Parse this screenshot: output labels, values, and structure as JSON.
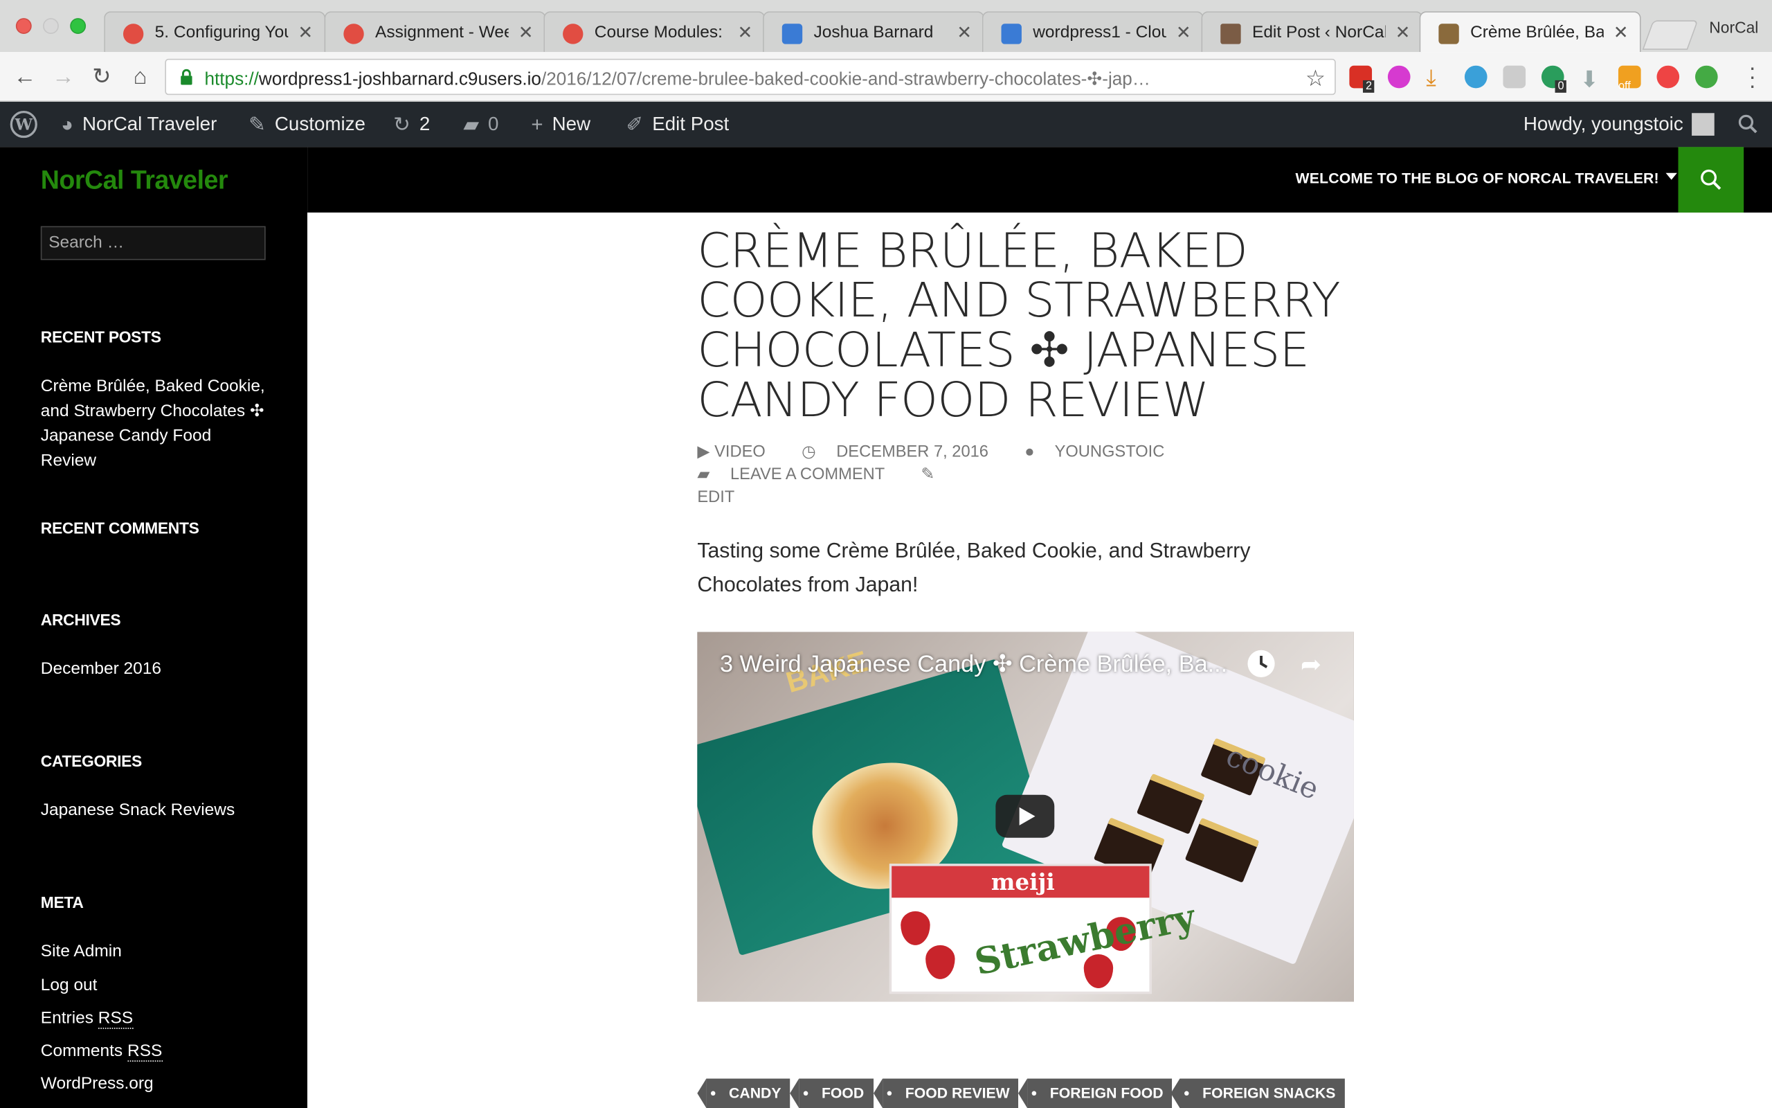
{
  "browser": {
    "tabs": [
      {
        "title": "5. Configuring You",
        "icon": "red-gear-icon",
        "color": "#e14d42"
      },
      {
        "title": "Assignment - Wee",
        "icon": "red-gear-icon",
        "color": "#e14d42"
      },
      {
        "title": "Course Modules: C",
        "icon": "red-gear-icon",
        "color": "#e14d42"
      },
      {
        "title": "Joshua Barnard",
        "icon": "cloud9-icon",
        "color": "#3a7bd5"
      },
      {
        "title": "wordpress1 - Clou",
        "icon": "cloud9-icon",
        "color": "#3a7bd5"
      },
      {
        "title": "Edit Post ‹ NorCal",
        "icon": "avatar-icon",
        "color": "#7b5c45"
      },
      {
        "title": "Crème Brûlée, Bak",
        "icon": "briefcase-icon",
        "color": "#8a6a3c"
      }
    ],
    "active_tab": 6,
    "profile_name": "NorCal",
    "url": {
      "scheme": "https://",
      "host": "wordpress1-joshbarnard.c9users.io",
      "path": "/2016/12/07/creme-brulee-baked-cookie-and-strawberry-chocolates-✣-jap…"
    },
    "extension_badges": {
      "ext1": "2",
      "ext2": "0",
      "ext3": "off"
    }
  },
  "adminbar": {
    "site_name": "NorCal Traveler",
    "customize": "Customize",
    "updates_count": "2",
    "comments_count": "0",
    "new_label": "New",
    "edit_post": "Edit Post",
    "howdy": "Howdy, youngstoic"
  },
  "site": {
    "title": "NorCal Traveler",
    "menu_item": "WELCOME TO THE BLOG OF NORCAL TRAVELER!",
    "accent": "#24890d"
  },
  "sidebar": {
    "search_placeholder": "Search …",
    "recent_posts_title": "RECENT POSTS",
    "recent_post": "Crème Brûlée, Baked Cookie, and Strawberry Chocolates ✣ Japanese Candy Food Review",
    "recent_comments_title": "RECENT COMMENTS",
    "archives_title": "ARCHIVES",
    "archive_item": "December 2016",
    "categories_title": "CATEGORIES",
    "category_item": "Japanese Snack Reviews",
    "meta_title": "META",
    "meta_links": {
      "site_admin": "Site Admin",
      "log_out": "Log out",
      "entries": "Entries",
      "comments": "Comments",
      "rss": "RSS",
      "wordpress": "WordPress.org"
    }
  },
  "post": {
    "title": "CRÈME BRÛLÉE, BAKED COOKIE, AND STRAWBERRY CHOCOLATES ✣ JAPANESE CANDY FOOD REVIEW",
    "format": "VIDEO",
    "date": "DECEMBER 7, 2016",
    "author": "YOUNGSTOIC",
    "comment_link": "LEAVE A COMMENT",
    "edit": "EDIT",
    "body": "Tasting some Crème Brûlée, Baked Cookie, and Strawberry Chocolates from Japan!",
    "video_title": "3 Weird Japanese Candy ✣ Crème Brûlée, Ba...",
    "video_box_bake": "BAKE",
    "video_box_cookie": "cookie",
    "video_box_meiji": "meiji",
    "video_box_strawberry": "Strawberry",
    "tags": [
      "CANDY",
      "FOOD",
      "FOOD REVIEW",
      "FOREIGN FOOD",
      "FOREIGN SNACKS"
    ]
  }
}
